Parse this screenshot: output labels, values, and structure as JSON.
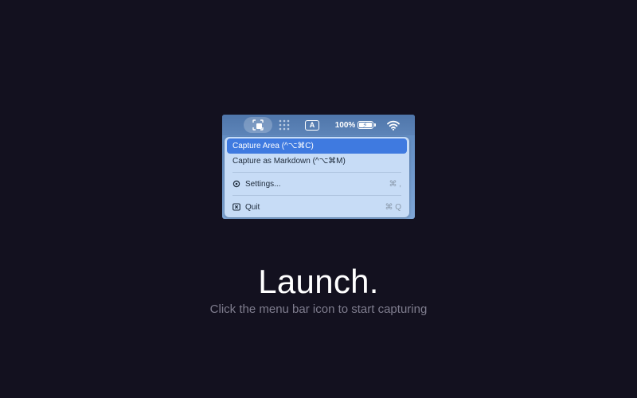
{
  "menubar": {
    "battery_percent": "100%",
    "input_indicator": "A",
    "icons": [
      "capture-icon",
      "grid-icon",
      "input-source-icon",
      "battery-charging-icon",
      "wifi-icon"
    ]
  },
  "menu": {
    "items": [
      {
        "label": "Capture Area (^⌥⌘C)",
        "shortcut": "",
        "active": true
      },
      {
        "label": "Capture as Markdown (^⌥⌘M)",
        "shortcut": "",
        "active": false
      },
      {
        "label": "Settings...",
        "shortcut": "⌘ ,",
        "icon": "gear-icon"
      },
      {
        "label": "Quit",
        "shortcut": "⌘ Q",
        "icon": "close-box-icon"
      }
    ]
  },
  "hero": {
    "title": "Launch.",
    "subtitle": "Click the menu bar icon to start capturing"
  },
  "colors": {
    "background": "#13111f",
    "menu_highlight": "#3f7ae0",
    "menu_background": "#c7dcf6"
  }
}
